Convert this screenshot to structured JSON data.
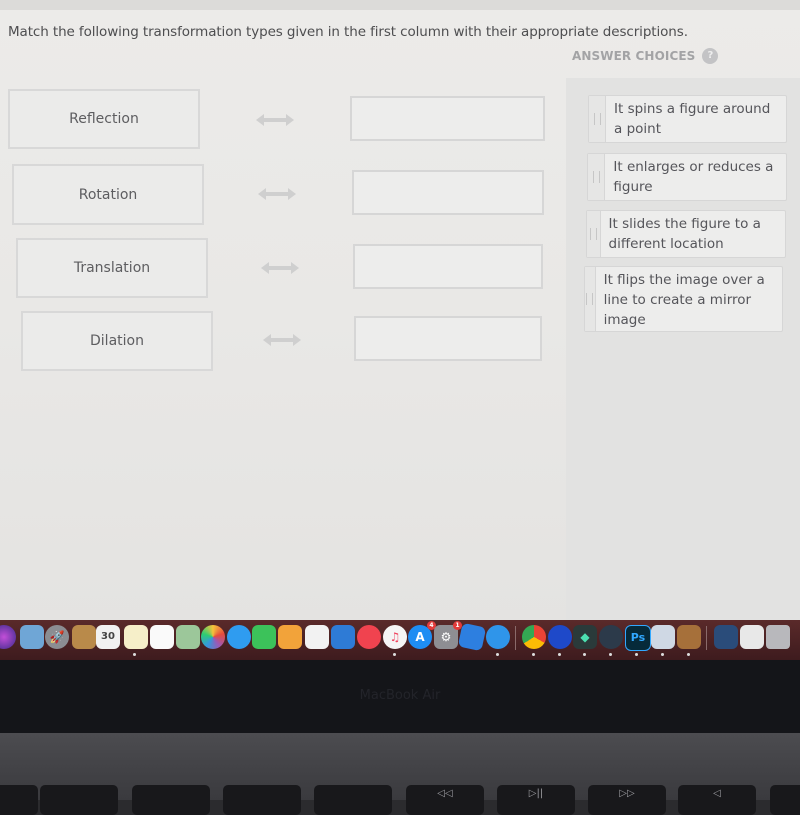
{
  "question": {
    "instructions": "Match the following transformation types given in the first column with their appropriate descriptions.",
    "answer_choices_label": "ANSWER CHOICES",
    "help_icon": "?"
  },
  "terms": [
    {
      "label": "Reflection"
    },
    {
      "label": "Rotation"
    },
    {
      "label": "Translation"
    },
    {
      "label": "Dilation"
    }
  ],
  "match_icon": "double-arrow-icon",
  "drop_targets": [
    {
      "value": ""
    },
    {
      "value": ""
    },
    {
      "value": ""
    },
    {
      "value": ""
    }
  ],
  "answer_choices": [
    {
      "text": "It spins a figure around a point"
    },
    {
      "text": "It enlarges or reduces a figure"
    },
    {
      "text": "It slides the figure to a different location"
    },
    {
      "text": "It flips the image over a line to create a mirror image"
    }
  ],
  "dock": {
    "apps": [
      {
        "name": "siri"
      },
      {
        "name": "preview"
      },
      {
        "name": "launchpad"
      },
      {
        "name": "contacts"
      },
      {
        "name": "calendar",
        "label": "30"
      },
      {
        "name": "notes"
      },
      {
        "name": "reminders"
      },
      {
        "name": "maps"
      },
      {
        "name": "photos"
      },
      {
        "name": "messages"
      },
      {
        "name": "facetime"
      },
      {
        "name": "pages"
      },
      {
        "name": "numbers"
      },
      {
        "name": "keynote"
      },
      {
        "name": "news"
      },
      {
        "name": "music"
      },
      {
        "name": "app-store",
        "badge": "4"
      },
      {
        "name": "system-preferences",
        "badge": "1"
      },
      {
        "name": "roblox"
      },
      {
        "name": "safari"
      },
      {
        "name": "chrome"
      },
      {
        "name": "vpn"
      },
      {
        "name": "filmora"
      },
      {
        "name": "quicktime"
      },
      {
        "name": "photoshop",
        "label": "Ps"
      },
      {
        "name": "image-capture"
      },
      {
        "name": "garageband"
      },
      {
        "name": "downloads"
      },
      {
        "name": "screenshots"
      },
      {
        "name": "trash"
      }
    ]
  },
  "device": {
    "model_label": "MacBook Air",
    "keys": [
      "",
      "",
      "",
      "",
      "",
      "◁◁",
      "▷||",
      "▷▷",
      "◁"
    ]
  }
}
